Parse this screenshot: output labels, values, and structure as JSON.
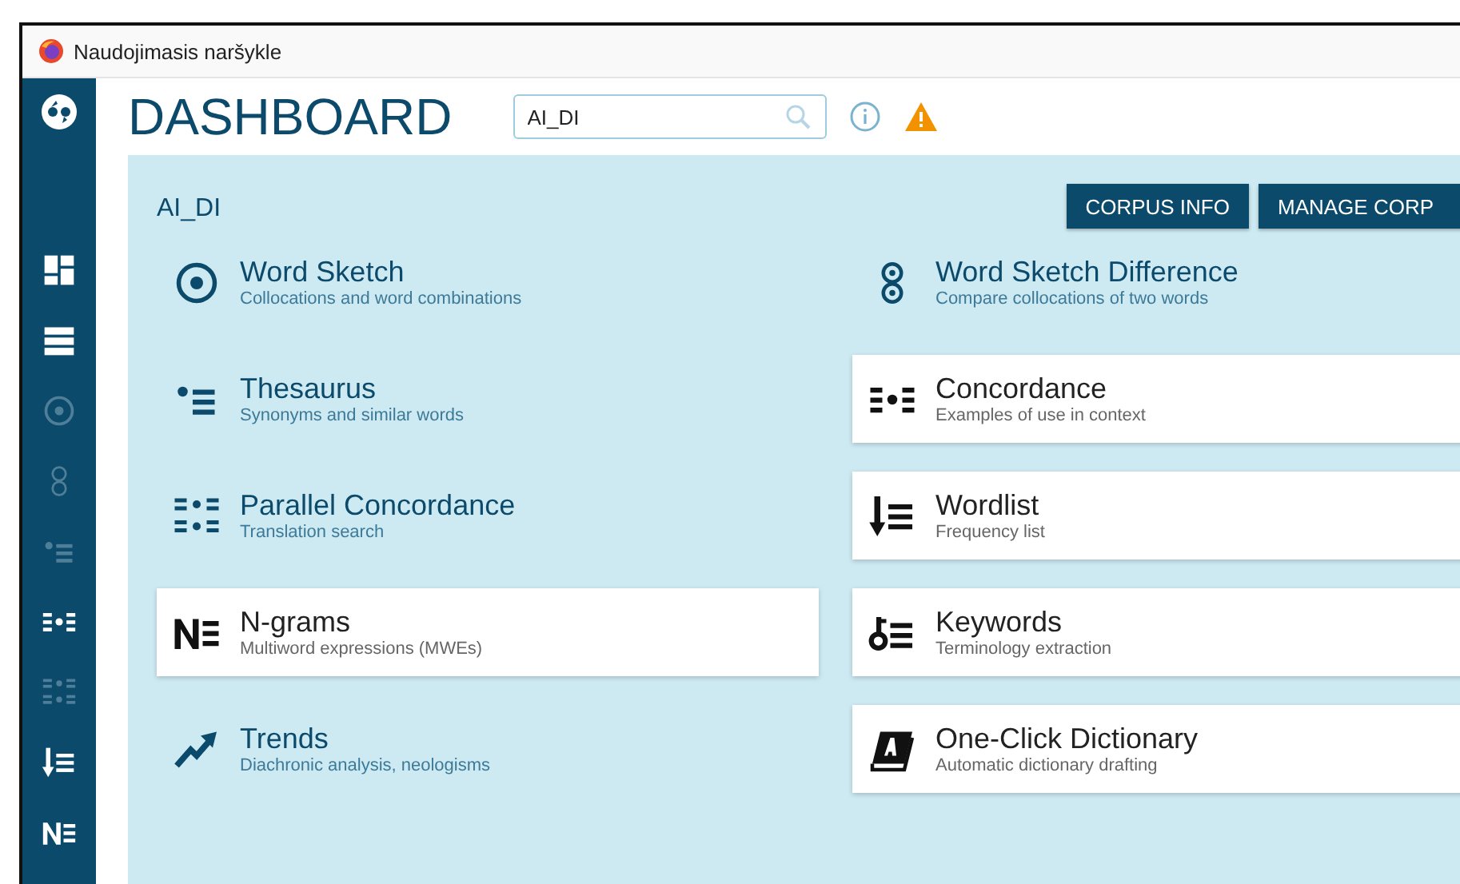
{
  "browser": {
    "tab_title": "Naudojimasis naršykle"
  },
  "sidebar": {
    "items": [
      {
        "disabled": false
      },
      {
        "disabled": false
      },
      {
        "disabled": true
      },
      {
        "disabled": true
      },
      {
        "disabled": true
      },
      {
        "disabled": false
      },
      {
        "disabled": true
      },
      {
        "disabled": false
      },
      {
        "disabled": false
      }
    ]
  },
  "header": {
    "title": "DASHBOARD",
    "search": {
      "value": "AI_DI"
    }
  },
  "panel": {
    "corpus_name": "AI_DI",
    "buttons": [
      "CORPUS INFO",
      "MANAGE CORP"
    ],
    "tools": [
      {
        "title": "Word Sketch",
        "subtitle": "Collocations and word combinations",
        "highlighted": false
      },
      {
        "title": "Word Sketch Difference",
        "subtitle": "Compare collocations of two words",
        "highlighted": false
      },
      {
        "title": "Thesaurus",
        "subtitle": "Synonyms and similar words",
        "highlighted": false
      },
      {
        "title": "Concordance",
        "subtitle": "Examples of use in context",
        "highlighted": true
      },
      {
        "title": "Parallel Concordance",
        "subtitle": "Translation search",
        "highlighted": false
      },
      {
        "title": "Wordlist",
        "subtitle": "Frequency list",
        "highlighted": true
      },
      {
        "title": "N-grams",
        "subtitle": "Multiword expressions (MWEs)",
        "highlighted": true
      },
      {
        "title": "Keywords",
        "subtitle": "Terminology extraction",
        "highlighted": true
      },
      {
        "title": "Trends",
        "subtitle": "Diachronic analysis, neologisms",
        "highlighted": false
      },
      {
        "title": "One-Click Dictionary",
        "subtitle": "Automatic dictionary drafting",
        "highlighted": true
      }
    ]
  }
}
